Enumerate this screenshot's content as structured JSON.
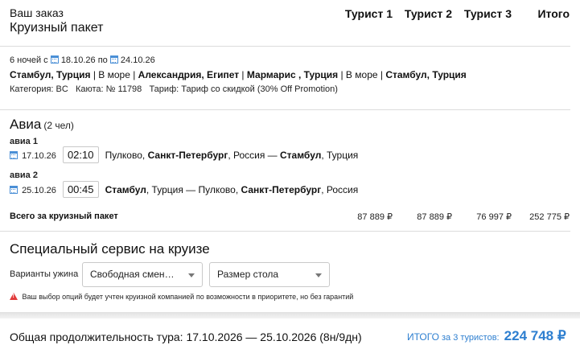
{
  "header": {
    "title": "Ваш заказ",
    "subtitle": "Круизный пакет",
    "columns": [
      "Турист 1",
      "Турист 2",
      "Турист 3",
      "Итого"
    ]
  },
  "cruise": {
    "nights": "6 ночей с",
    "date_from": "18.10.26",
    "date_sep": "по",
    "date_to": "24.10.26",
    "route": [
      {
        "text": "Стамбул, Турция",
        "bold": true
      },
      {
        "text": " | В море | ",
        "bold": false
      },
      {
        "text": "Александрия, Египет",
        "bold": true
      },
      {
        "text": " | ",
        "bold": false
      },
      {
        "text": "Мармарис , Турция",
        "bold": true
      },
      {
        "text": " | В море | ",
        "bold": false
      },
      {
        "text": "Стамбул, Турция",
        "bold": true
      }
    ],
    "details": "Категория: BC   Каюта: № 11798   Тариф: Тариф со скидкой (30% Off Promotion)"
  },
  "avia": {
    "title": "Авиа",
    "count": "(2 чел)",
    "flights": [
      {
        "label": "авиа 1",
        "date": "17.10.26",
        "time": "02:10",
        "parts": [
          {
            "text": "Пулково, ",
            "bold": false
          },
          {
            "text": "Санкт-Петербург",
            "bold": true
          },
          {
            "text": ", Россия — ",
            "bold": false
          },
          {
            "text": "Стамбул",
            "bold": true
          },
          {
            "text": ", Турция",
            "bold": false
          }
        ]
      },
      {
        "label": "авиа 2",
        "date": "25.10.26",
        "time": "00:45",
        "parts": [
          {
            "text": "Стамбул",
            "bold": true
          },
          {
            "text": ", Турция — Пулково, ",
            "bold": false
          },
          {
            "text": "Санкт-Петербург",
            "bold": true
          },
          {
            "text": ", Россия",
            "bold": false
          }
        ]
      }
    ]
  },
  "package_total": {
    "label": "Всего за круизный пакет",
    "values": [
      "87 889 ₽",
      "87 889 ₽",
      "76 997 ₽",
      "252 775 ₽"
    ]
  },
  "special": {
    "title": "Специальный сервис на круизе",
    "dinner_label": "Варианты ужина",
    "dinner_value": "Свободная смена пит...",
    "table_value": "Размер стола",
    "warning": "Ваш выбор опций будет учтен круизной компанией по возможности в приоритете, но без гарантий"
  },
  "footer": {
    "duration": "Общая продолжительность тура: 17.10.2026 — 25.10.2026 (8н/9дн)",
    "total_label": "ИТОГО",
    "total_for": "за 3 туристов:",
    "total_value": "224 748 ₽",
    "accent_color": "#2e7fd0"
  }
}
